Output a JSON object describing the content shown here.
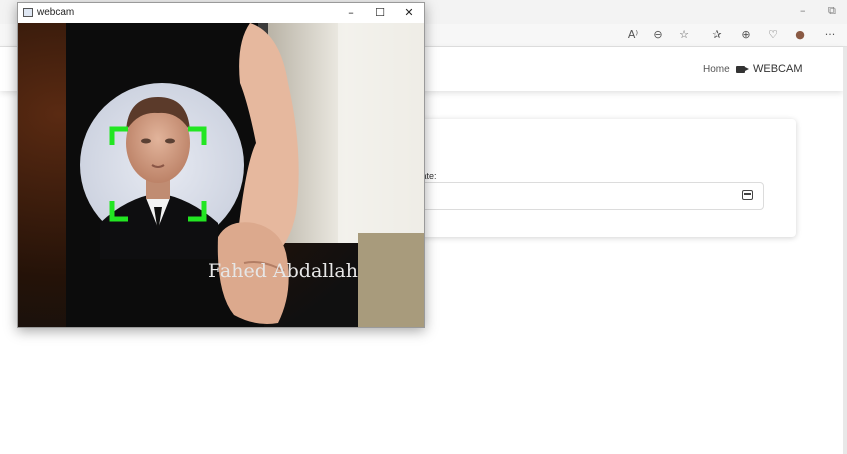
{
  "browser": {
    "min_glyph": "–",
    "restore_glyph": "⧉",
    "toolbar_icons": [
      "A⁾",
      "⊖",
      "☆",
      "✰",
      "⊕",
      "♡",
      "●",
      "···"
    ]
  },
  "navbar": {
    "home": "Home",
    "webcam": "WEBCAM"
  },
  "form": {
    "date_label": "t Date:"
  },
  "webcam_window": {
    "title": "webcam",
    "min": "–",
    "max": "☐",
    "close": "✕",
    "recognized_name": "Fahed Abdallah"
  },
  "colors": {
    "detection_box": "#22e622",
    "label_text": "#e6e6e6"
  }
}
